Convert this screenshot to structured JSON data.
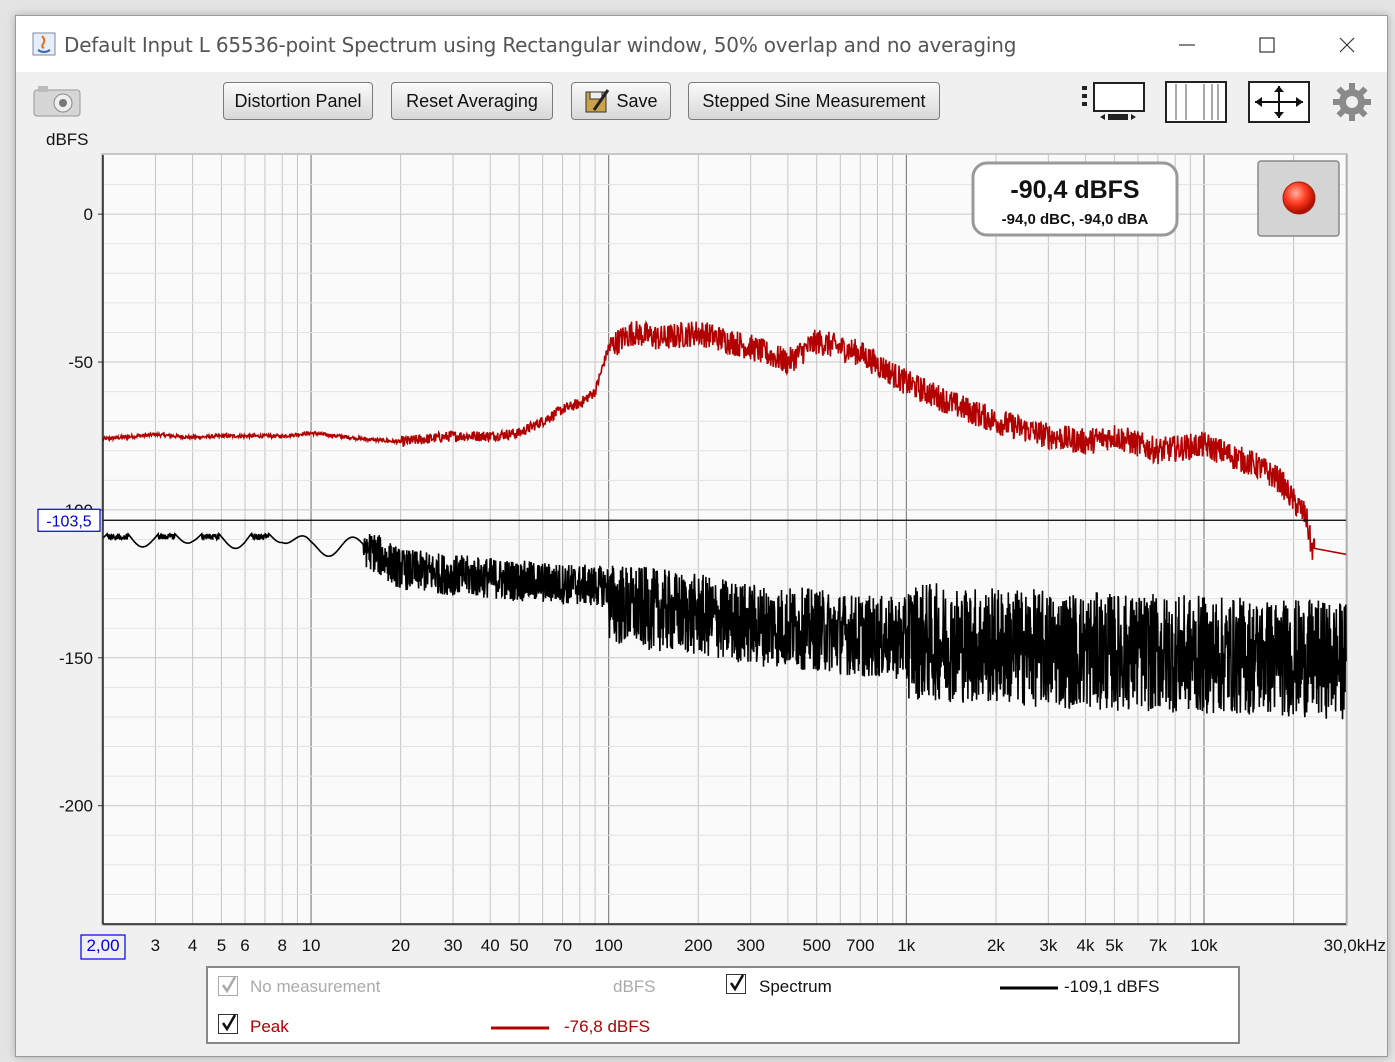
{
  "window": {
    "title": "Default Input L 65536-point Spectrum using Rectangular window, 50% overlap and no averaging",
    "controls": [
      "minimize",
      "maximize",
      "close"
    ]
  },
  "toolbar": {
    "distortion_label": "Distortion Panel",
    "reset_label": "Reset Averaging",
    "save_label": "Save",
    "stepped_label": "Stepped Sine Measurement",
    "icons": [
      "camera-icon",
      "save-icon",
      "graph-layout-icon",
      "bars-icon",
      "resize-arrows-icon",
      "gear-icon"
    ]
  },
  "readout": {
    "main": "-90,4 dBFS",
    "sub": "-94,0 dBC, -94,0 dBA"
  },
  "record_button": {
    "color": "#ff3a1f"
  },
  "chart_data": {
    "type": "line",
    "ylabel": "dBFS",
    "y_ticks": [
      "0",
      "-50",
      "-100",
      "-150",
      "-200"
    ],
    "y_tick_values": [
      0,
      -50,
      -100,
      -150,
      -200
    ],
    "ylim": [
      -240,
      20
    ],
    "x_scale": "log",
    "xlim": [
      2,
      30000
    ],
    "x_ticks": [
      "2,00",
      "3",
      "4",
      "5",
      "6",
      "8",
      "10",
      "20",
      "30",
      "40",
      "50",
      "70",
      "100",
      "200",
      "300",
      "500",
      "700",
      "1k",
      "2k",
      "3k",
      "4k",
      "5k",
      "7k",
      "10k",
      "30,0kHz"
    ],
    "x_tick_values": [
      2,
      3,
      4,
      5,
      6,
      8,
      10,
      20,
      30,
      40,
      50,
      70,
      100,
      200,
      300,
      500,
      700,
      1000,
      2000,
      3000,
      4000,
      5000,
      7000,
      10000,
      30000
    ],
    "cursor": {
      "value": -103.5,
      "label": "-103,5"
    },
    "grid": true,
    "series": [
      {
        "name": "Peak",
        "color": "#b20000",
        "points": [
          [
            2,
            -76
          ],
          [
            3,
            -74.5
          ],
          [
            4,
            -75.5
          ],
          [
            5,
            -75
          ],
          [
            6,
            -75
          ],
          [
            8,
            -75
          ],
          [
            10,
            -74
          ],
          [
            15,
            -76
          ],
          [
            20,
            -77
          ],
          [
            30,
            -75
          ],
          [
            40,
            -75
          ],
          [
            50,
            -74
          ],
          [
            60,
            -70
          ],
          [
            70,
            -66
          ],
          [
            80,
            -64
          ],
          [
            90,
            -60
          ],
          [
            100,
            -45
          ],
          [
            120,
            -40
          ],
          [
            150,
            -42
          ],
          [
            200,
            -40
          ],
          [
            300,
            -45
          ],
          [
            400,
            -50
          ],
          [
            500,
            -43
          ],
          [
            700,
            -47
          ],
          [
            1000,
            -57
          ],
          [
            1500,
            -65
          ],
          [
            2000,
            -70
          ],
          [
            3000,
            -75
          ],
          [
            4000,
            -77
          ],
          [
            5000,
            -75
          ],
          [
            7000,
            -80
          ],
          [
            10000,
            -78
          ],
          [
            15000,
            -85
          ],
          [
            18000,
            -90
          ],
          [
            20000,
            -97
          ],
          [
            22000,
            -102
          ],
          [
            23000,
            -113
          ],
          [
            30000,
            -115
          ]
        ]
      },
      {
        "name": "Spectrum",
        "color": "#000000",
        "points": [
          [
            2,
            -108
          ],
          [
            3,
            -110
          ],
          [
            4,
            -108
          ],
          [
            5,
            -110
          ],
          [
            6,
            -110
          ],
          [
            8,
            -108
          ],
          [
            10,
            -113
          ],
          [
            15,
            -112
          ],
          [
            20,
            -120
          ],
          [
            30,
            -122
          ],
          [
            40,
            -123
          ],
          [
            50,
            -124
          ],
          [
            70,
            -125
          ],
          [
            100,
            -126
          ],
          [
            200,
            -130
          ],
          [
            300,
            -133
          ],
          [
            500,
            -135
          ],
          [
            700,
            -137
          ],
          [
            1000,
            -138
          ],
          [
            2000,
            -140
          ],
          [
            3000,
            -141
          ],
          [
            5000,
            -142
          ],
          [
            10000,
            -143
          ],
          [
            20000,
            -144
          ],
          [
            30000,
            -145
          ]
        ]
      }
    ]
  },
  "legend": {
    "no_measurement": {
      "label": "No measurement",
      "unit": "dBFS",
      "checked": true,
      "enabled": false
    },
    "spectrum": {
      "label": "Spectrum",
      "value": "-109,1 dBFS",
      "checked": true,
      "color": "#000000"
    },
    "peak": {
      "label": "Peak",
      "value": "-76,8 dBFS",
      "checked": true,
      "color": "#b20000"
    }
  }
}
